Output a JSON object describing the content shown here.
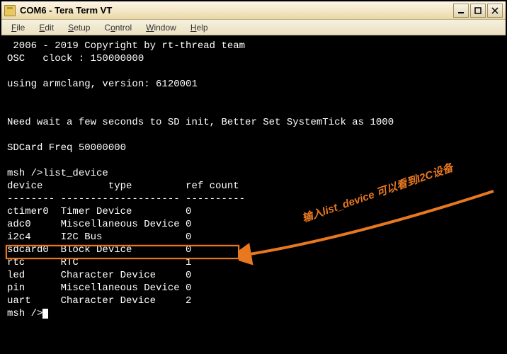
{
  "window": {
    "title": "COM6 - Tera Term VT"
  },
  "menu": {
    "items": [
      {
        "label": "File",
        "ul": "F"
      },
      {
        "label": "Edit",
        "ul": "E"
      },
      {
        "label": "Setup",
        "ul": "S"
      },
      {
        "label": "Control",
        "ul": "o"
      },
      {
        "label": "Window",
        "ul": "W"
      },
      {
        "label": "Help",
        "ul": "H"
      }
    ]
  },
  "terminal": {
    "lines": [
      " 2006 - 2019 Copyright by rt-thread team",
      "OSC   clock : 150000000",
      "",
      "using armclang, version: 6120001",
      "",
      "",
      "Need wait a few seconds to SD init, Better Set SystemTick as 1000",
      "",
      "SDCard Freq 50000000",
      "",
      "msh />list_device",
      "device           type         ref count",
      "-------- -------------------- ----------",
      "ctimer0  Timer Device         0",
      "adc0     Miscellaneous Device 0",
      "i2c4     I2C Bus              0",
      "sdcard0  Block Device         0",
      "rtc      RTC                  1",
      "led      Character Device     0",
      "pin      Miscellaneous Device 0",
      "uart     Character Device     2",
      "msh />"
    ]
  },
  "callout": {
    "prefix": "输入",
    "cmd": "list_device",
    "mid": " 可以看到",
    "bold": "I2C",
    "suffix": "设备"
  }
}
